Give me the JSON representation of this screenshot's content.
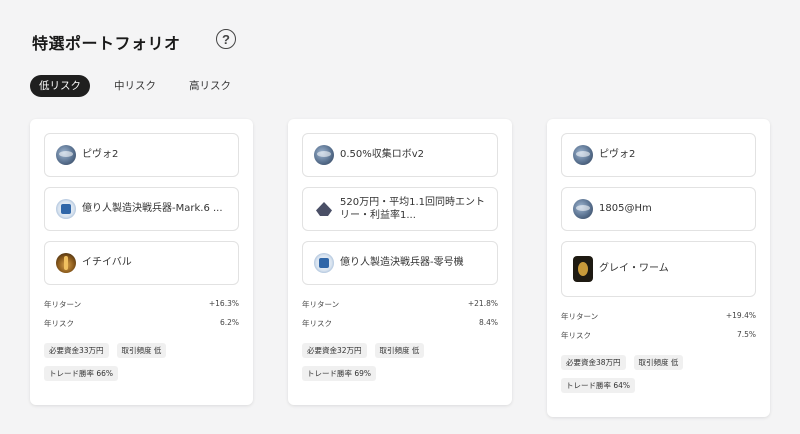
{
  "page": {
    "title": "特選ポートフォリオ",
    "help_glyph": "?"
  },
  "tabs": [
    {
      "label": "低リスク",
      "active": true
    },
    {
      "label": "中リスク",
      "active": false
    },
    {
      "label": "高リスク",
      "active": false
    }
  ],
  "labels": {
    "annual_return": "年リターン",
    "annual_risk": "年リスク"
  },
  "portfolios": [
    {
      "items": [
        {
          "name": "ピヴォ2",
          "icon": "globe-icon"
        },
        {
          "name": "億り人製造決戦兵器-Mark.6 ...",
          "icon": "mark-icon"
        },
        {
          "name": "イチイバル",
          "icon": "wheat-icon"
        }
      ],
      "annual_return": "+16.3%",
      "annual_risk": "6.2%",
      "tags": [
        "必要資金33万円",
        "取引頻度 低",
        "トレード勝率 66%"
      ]
    },
    {
      "items": [
        {
          "name": "0.50%収集ロボv2",
          "icon": "globe-icon"
        },
        {
          "name": "520万円・平均1.1回同時エントリー・利益率1...",
          "icon": "robot-icon"
        },
        {
          "name": "億り人製造決戦兵器-零号機",
          "icon": "mark-icon"
        }
      ],
      "annual_return": "+21.8%",
      "annual_risk": "8.4%",
      "tags": [
        "必要資金32万円",
        "取引頻度 低",
        "トレード勝率 69%"
      ]
    },
    {
      "items": [
        {
          "name": "ピヴォ2",
          "icon": "globe-icon"
        },
        {
          "name": "1805@Hm",
          "icon": "globe-icon"
        },
        {
          "name": "グレイ・ワーム",
          "icon": "dragon-icon"
        }
      ],
      "annual_return": "+19.4%",
      "annual_risk": "7.5%",
      "tags": [
        "必要資金38万円",
        "取引頻度 低",
        "トレード勝率 64%"
      ]
    }
  ]
}
